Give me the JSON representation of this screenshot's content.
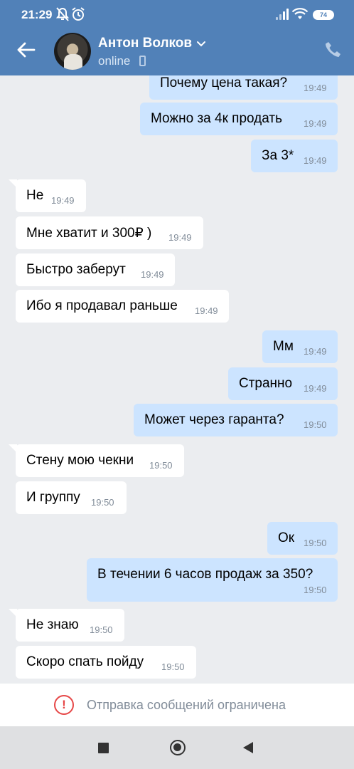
{
  "status_bar": {
    "time": "21:29",
    "battery": "74"
  },
  "contact": {
    "name": "Антон Волков",
    "status": "online"
  },
  "messages": [
    {
      "dir": "out",
      "text": "Почему цена такая?",
      "time": "19:49"
    },
    {
      "dir": "out",
      "text": "Можно за 4к продать",
      "time": "19:49"
    },
    {
      "dir": "out",
      "text": "За 3*",
      "time": "19:49"
    },
    {
      "dir": "in",
      "text": "Не",
      "time": "19:49"
    },
    {
      "dir": "in",
      "text": "Мне хватит и 300₽ )",
      "time": "19:49"
    },
    {
      "dir": "in",
      "text": "Быстро заберут",
      "time": "19:49"
    },
    {
      "dir": "in",
      "text": "Ибо я продавал раньше",
      "time": "19:49"
    },
    {
      "dir": "out",
      "text": "Мм",
      "time": "19:49"
    },
    {
      "dir": "out",
      "text": "Странно",
      "time": "19:49"
    },
    {
      "dir": "out",
      "text": "Может через гаранта?",
      "time": "19:50"
    },
    {
      "dir": "in",
      "text": "Стену мою чекни",
      "time": "19:50"
    },
    {
      "dir": "in",
      "text": "И группу",
      "time": "19:50"
    },
    {
      "dir": "out",
      "text": "Ок",
      "time": "19:50"
    },
    {
      "dir": "out",
      "text": "В течении 6 часов продаж за 350?",
      "time": "19:50"
    },
    {
      "dir": "in",
      "text": "Не знаю",
      "time": "19:50"
    },
    {
      "dir": "in",
      "text": "Скоро спать пойду",
      "time": "19:50"
    }
  ],
  "restriction": {
    "text": "Отправка сообщений ограничена"
  },
  "colors": {
    "header": "#5181b8",
    "outgoing": "#cce4ff",
    "incoming": "#ffffff",
    "background": "#ebedf0",
    "warning": "#e64646"
  }
}
